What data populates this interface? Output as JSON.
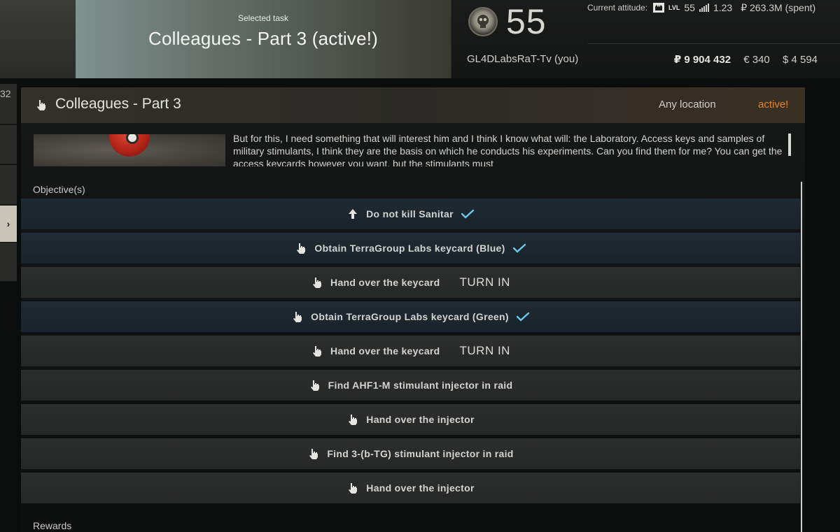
{
  "selected_task": {
    "label": "Selected task",
    "title": "Colleagues - Part 3 (active!)"
  },
  "profile": {
    "level": "55",
    "nickname": "GL4DLabsRaT-Tv (you)",
    "attitude_label": "Current attitude:",
    "lvl_label": "LVL",
    "lvl_value": "55",
    "standing": "1.23",
    "spent": "₽ 263.3M (spent)",
    "roubles": "₽ 9 904 432",
    "euros": "€ 340",
    "dollars": "$ 4 594"
  },
  "sidebar": {
    "count_fragment": "32",
    "arrow": "›"
  },
  "quest": {
    "title": "Colleagues - Part 3",
    "location": "Any location",
    "status": "active!",
    "description": "But for this, I need something that will interest him and I think I know what will: the Laboratory. Access keys and samples of military stimulants, I think they are the basis on which he conducts his experiments. Can you find them for me? You can get the access keycards however you want, but the stimulants must",
    "objectives_label": "Objective(s)",
    "rewards_label": "Rewards",
    "objectives": [
      {
        "text": "Do not kill Sanitar",
        "icon": "arrow-up-icon",
        "done": true,
        "action": ""
      },
      {
        "text": "Obtain TerraGroup Labs keycard (Blue)",
        "icon": "hand-icon",
        "done": true,
        "action": ""
      },
      {
        "text": "Hand over the keycard",
        "icon": "hand-icon",
        "done": false,
        "action": "TURN IN"
      },
      {
        "text": "Obtain TerraGroup Labs keycard (Green)",
        "icon": "hand-icon",
        "done": true,
        "action": ""
      },
      {
        "text": "Hand over the keycard",
        "icon": "hand-icon",
        "done": false,
        "action": "TURN IN"
      },
      {
        "text": "Find AHF1-M stimulant injector in raid",
        "icon": "hand-icon",
        "done": false,
        "action": ""
      },
      {
        "text": "Hand over the injector",
        "icon": "hand-icon",
        "done": false,
        "action": ""
      },
      {
        "text": "Find 3-(b-TG) stimulant injector in raid",
        "icon": "hand-icon",
        "done": false,
        "action": ""
      },
      {
        "text": "Hand over the injector",
        "icon": "hand-icon",
        "done": false,
        "action": ""
      }
    ]
  },
  "colors": {
    "active_status": "#e2832c",
    "check": "#6ec9e6",
    "done_row": "#1c2730",
    "todo_row": "#2a2b2b"
  }
}
